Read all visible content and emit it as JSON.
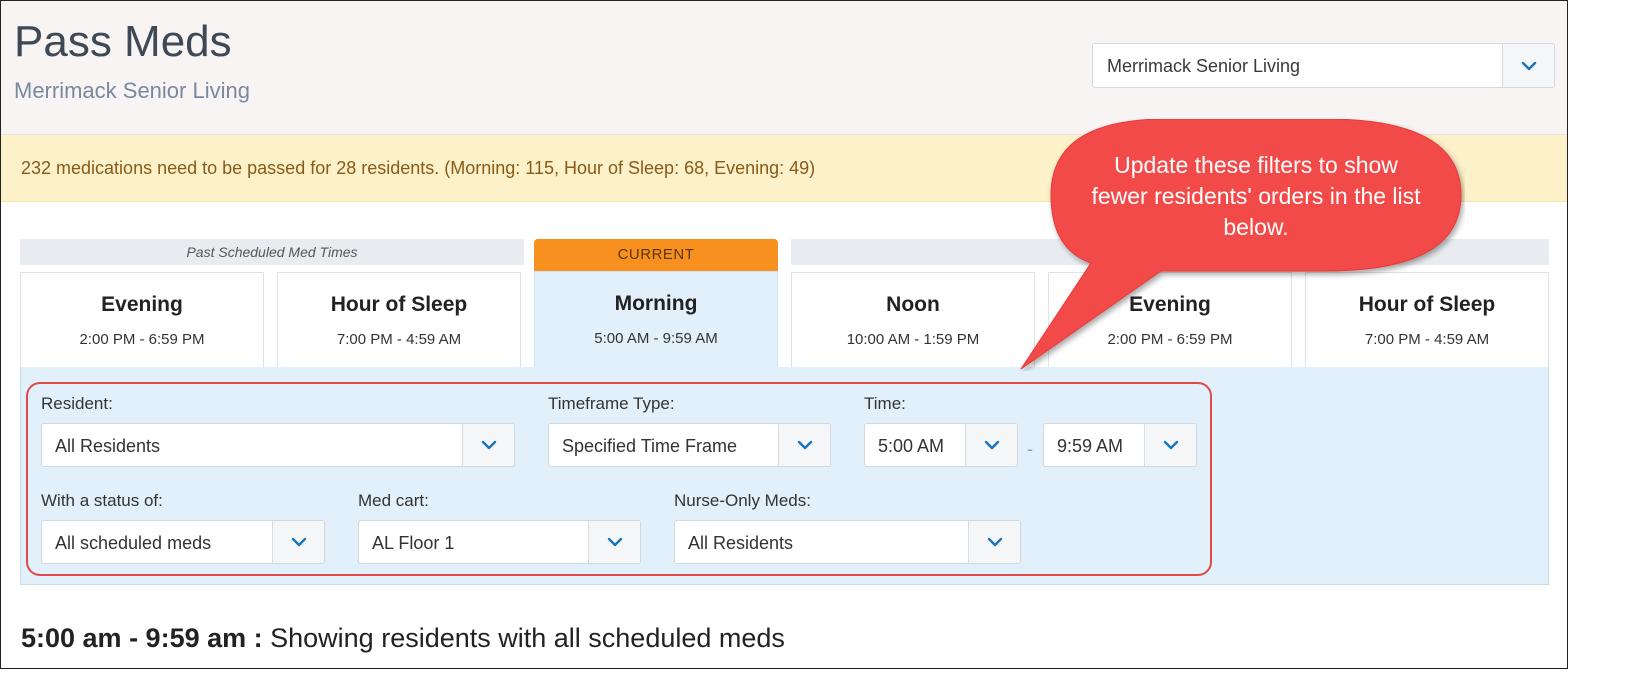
{
  "header": {
    "title": "Pass Meds",
    "subtitle": "Merrimack Senior Living",
    "facility_select": {
      "value": "Merrimack Senior Living",
      "icon": "chevron-down-icon"
    }
  },
  "alert": {
    "text": "232 medications need to be passed for 28 residents. (Morning: 115, Hour of Sleep: 68, Evening: 49)"
  },
  "timeline": {
    "past_label": "Past Scheduled Med Times",
    "current_label": "CURRENT",
    "tabs": [
      {
        "name": "Evening",
        "time": "2:00 PM - 6:59 PM"
      },
      {
        "name": "Hour of Sleep",
        "time": "7:00 PM - 4:59 AM"
      },
      {
        "name": "Morning",
        "time": "5:00 AM - 9:59 AM"
      },
      {
        "name": "Noon",
        "time": "10:00 AM - 1:59 PM"
      },
      {
        "name": "Evening",
        "time": "2:00 PM - 6:59 PM"
      },
      {
        "name": "Hour of Sleep",
        "time": "7:00 PM - 4:59 AM"
      }
    ],
    "active_index": 2
  },
  "filters": {
    "resident": {
      "label": "Resident:",
      "value": "All Residents"
    },
    "timeframe_type": {
      "label": "Timeframe Type:",
      "value": "Specified Time Frame"
    },
    "time": {
      "label": "Time:",
      "start": "5:00 AM",
      "separator": "-",
      "end": "9:59 AM"
    },
    "status": {
      "label": "With a status of:",
      "value": "All scheduled meds"
    },
    "med_cart": {
      "label": "Med cart:",
      "value": "AL Floor 1"
    },
    "nurse_only": {
      "label": "Nurse-Only Meds:",
      "value": "All Residents"
    }
  },
  "callout": {
    "text": "Update these filters to show fewer residents' orders in the list below."
  },
  "summary": {
    "range": "5:00 am - 9:59 am :",
    "text": " Showing residents with all scheduled meds"
  },
  "colors": {
    "accent_blue": "#1a75b8",
    "current_orange": "#f7901e",
    "callout_red": "#f24848",
    "alert_bg": "#fcf1c9"
  }
}
